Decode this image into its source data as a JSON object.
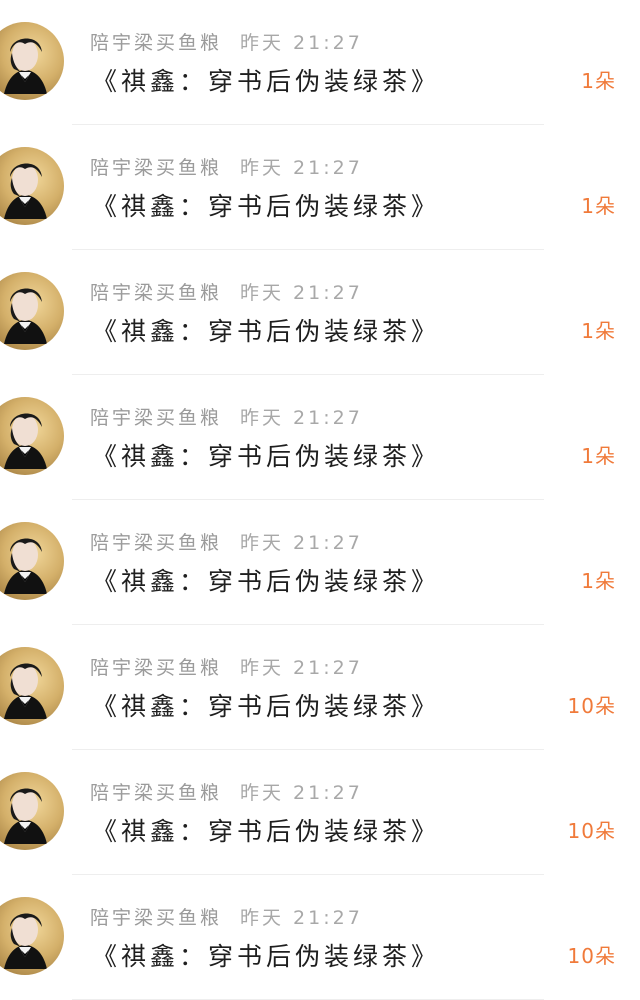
{
  "items": [
    {
      "username": "陪宇梁买鱼粮",
      "time": "昨天 21:27",
      "title": "《祺鑫：穿书后伪装绿茶》",
      "count": "1朵"
    },
    {
      "username": "陪宇梁买鱼粮",
      "time": "昨天 21:27",
      "title": "《祺鑫：穿书后伪装绿茶》",
      "count": "1朵"
    },
    {
      "username": "陪宇梁买鱼粮",
      "time": "昨天 21:27",
      "title": "《祺鑫：穿书后伪装绿茶》",
      "count": "1朵"
    },
    {
      "username": "陪宇梁买鱼粮",
      "time": "昨天 21:27",
      "title": "《祺鑫：穿书后伪装绿茶》",
      "count": "1朵"
    },
    {
      "username": "陪宇梁买鱼粮",
      "time": "昨天 21:27",
      "title": "《祺鑫：穿书后伪装绿茶》",
      "count": "1朵"
    },
    {
      "username": "陪宇梁买鱼粮",
      "time": "昨天 21:27",
      "title": "《祺鑫：穿书后伪装绿茶》",
      "count": "10朵"
    },
    {
      "username": "陪宇梁买鱼粮",
      "time": "昨天 21:27",
      "title": "《祺鑫：穿书后伪装绿茶》",
      "count": "10朵"
    },
    {
      "username": "陪宇梁买鱼粮",
      "time": "昨天 21:27",
      "title": "《祺鑫：穿书后伪装绿茶》",
      "count": "10朵"
    }
  ],
  "colors": {
    "meta_text": "#9a9a9a",
    "title_text": "#1f1f1f",
    "gift_accent": "#f07a3a",
    "divider": "#eeeeee"
  },
  "icons": {
    "avatar": "user-avatar-icon"
  }
}
